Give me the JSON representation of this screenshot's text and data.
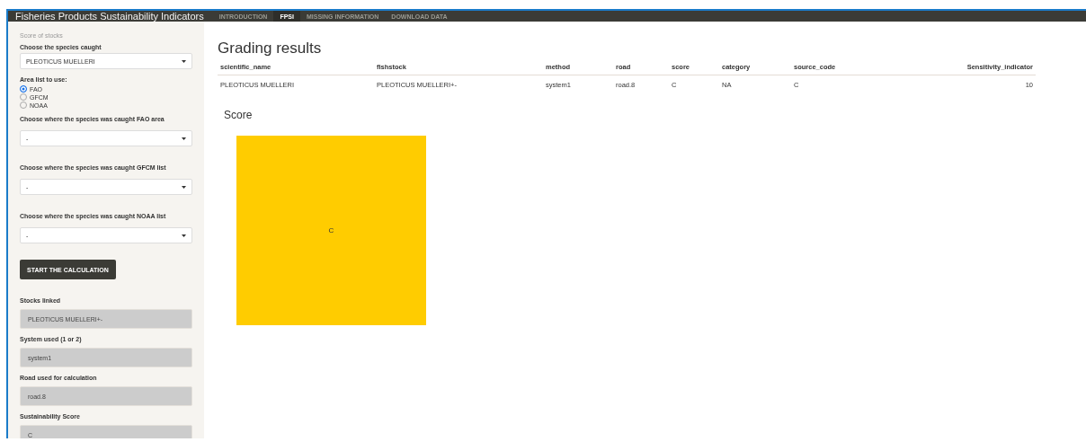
{
  "navbar": {
    "title": "Fisheries Products Sustainability Indicators",
    "tabs": [
      {
        "label": "INTRODUCTION",
        "selected": false
      },
      {
        "label": "FPSI",
        "selected": true
      },
      {
        "label": "MISSING INFORMATION",
        "selected": false
      },
      {
        "label": "DOWNLOAD DATA",
        "selected": false
      }
    ]
  },
  "sidebar": {
    "heading": "Score of stocks",
    "species": {
      "label": "Choose the species caught",
      "value": "PLEOTICUS MUELLERI"
    },
    "area_list": {
      "label": "Area list to use:",
      "options": [
        {
          "label": "FAO",
          "selected": true
        },
        {
          "label": "GFCM",
          "selected": false
        },
        {
          "label": "NOAA",
          "selected": false
        }
      ]
    },
    "area_selects": [
      {
        "label": "Choose where the species was caught FAO area",
        "value": "-"
      },
      {
        "label": "Choose where the species was caught GFCM list",
        "value": "-"
      },
      {
        "label": "Choose where the species was caught NOAA list",
        "value": "-"
      }
    ],
    "button": "START THE CALCULATION",
    "outputs": [
      {
        "label": "Stocks linked",
        "value": "PLEOTICUS MUELLERI+-"
      },
      {
        "label": "System used (1 or 2)",
        "value": "system1"
      },
      {
        "label": "Road used for calculation",
        "value": "road.8"
      },
      {
        "label": "Sustainability Score",
        "value": "C"
      }
    ]
  },
  "main": {
    "title": "Grading results",
    "table": {
      "columns": [
        "scientific_name",
        "fishstock",
        "method",
        "road",
        "score",
        "category",
        "source_code",
        "Sensitivity_indicator"
      ],
      "rows": [
        [
          "PLEOTICUS MUELLERI",
          "PLEOTICUS MUELLERI+-",
          "system1",
          "road.8",
          "C",
          "NA",
          "C",
          "10"
        ]
      ]
    },
    "score_heading": "Score",
    "score_tile": {
      "label": "C",
      "color": "#ffcc00"
    }
  }
}
